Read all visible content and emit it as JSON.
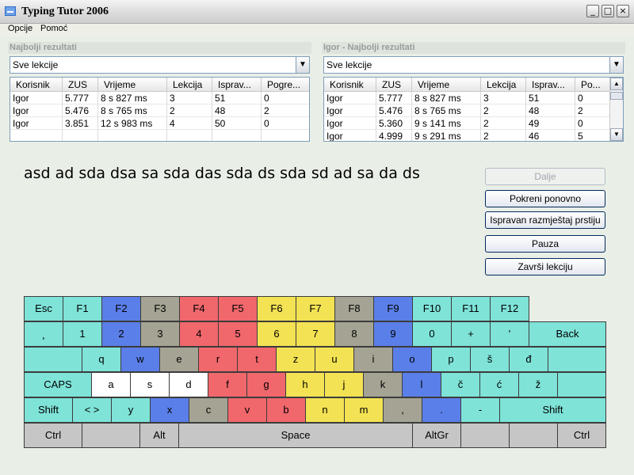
{
  "window": {
    "title": "Typing Tutor 2006",
    "buttons": [
      "_",
      "□",
      "×"
    ]
  },
  "menu": [
    "Opcije",
    "Pomoć"
  ],
  "panels": [
    {
      "title": "Najbolji rezultati",
      "filter": "Sve lekcije",
      "columns": [
        "Korisnik",
        "ZUS",
        "Vrijeme",
        "Lekcija",
        "Isprav...",
        "Pogre..."
      ],
      "rows": [
        [
          "Igor",
          "5.777",
          "8 s 827 ms",
          "3",
          "51",
          "0"
        ],
        [
          "Igor",
          "5.476",
          "8 s 765 ms",
          "2",
          "48",
          "2"
        ],
        [
          "Igor",
          "3.851",
          "12 s 983 ms",
          "4",
          "50",
          "0"
        ],
        [
          "",
          "",
          "",
          "",
          "",
          ""
        ]
      ],
      "scrollbar": false
    },
    {
      "title": "Igor - Najbolji rezultati",
      "filter": "Sve lekcije",
      "columns": [
        "Korisnik",
        "ZUS",
        "Vrijeme",
        "Lekcija",
        "Isprav...",
        "Po..."
      ],
      "rows": [
        [
          "Igor",
          "5.777",
          "8 s 827 ms",
          "3",
          "51",
          "0"
        ],
        [
          "Igor",
          "5.476",
          "8 s 765 ms",
          "2",
          "48",
          "2"
        ],
        [
          "Igor",
          "5.360",
          "9 s 141 ms",
          "2",
          "49",
          "0"
        ],
        [
          "Igor",
          "4.999",
          "9 s 291 ms",
          "2",
          "46",
          "5"
        ]
      ],
      "scrollbar": true
    }
  ],
  "lesson_text": "asd ad sda dsa sa sda das sda ds sda sd ad sa da ds",
  "actions": [
    {
      "label": "Dalje",
      "disabled": true
    },
    {
      "label": "Pokreni ponovno",
      "disabled": false
    },
    {
      "label": "Ispravan razmještaj prstiju",
      "disabled": false
    },
    {
      "label": "Pauza",
      "disabled": false
    },
    {
      "label": "Završi lekciju",
      "disabled": false
    }
  ],
  "colors": {
    "teal": "#7FE3D8",
    "blue": "#5B7FE8",
    "gray": "#A5A393",
    "red": "#F0676C",
    "yellow": "#F3E253",
    "white": "#FFFFFF",
    "light": "#C6C6C6"
  },
  "keyboard": [
    [
      {
        "label": "Esc",
        "color": "teal"
      },
      {
        "label": "F1",
        "color": "teal"
      },
      {
        "label": "F2",
        "color": "blue"
      },
      {
        "label": "F3",
        "color": "gray"
      },
      {
        "label": "F4",
        "color": "red"
      },
      {
        "label": "F5",
        "color": "red"
      },
      {
        "label": "F6",
        "color": "yellow"
      },
      {
        "label": "F7",
        "color": "yellow"
      },
      {
        "label": "F8",
        "color": "gray"
      },
      {
        "label": "F9",
        "color": "blue"
      },
      {
        "label": "F10",
        "color": "teal"
      },
      {
        "label": "F11",
        "color": "teal"
      },
      {
        "label": "F12",
        "color": "teal"
      }
    ],
    [
      {
        "label": "¸",
        "color": "teal"
      },
      {
        "label": "1",
        "color": "teal"
      },
      {
        "label": "2",
        "color": "blue"
      },
      {
        "label": "3",
        "color": "gray"
      },
      {
        "label": "4",
        "color": "red"
      },
      {
        "label": "5",
        "color": "red"
      },
      {
        "label": "6",
        "color": "yellow"
      },
      {
        "label": "7",
        "color": "yellow"
      },
      {
        "label": "8",
        "color": "gray"
      },
      {
        "label": "9",
        "color": "blue"
      },
      {
        "label": "0",
        "color": "teal"
      },
      {
        "label": "+",
        "color": "teal"
      },
      {
        "label": "'",
        "color": "teal"
      },
      {
        "label": "Back",
        "color": "teal"
      }
    ],
    [
      {
        "label": "",
        "color": "teal"
      },
      {
        "label": "q",
        "color": "teal"
      },
      {
        "label": "w",
        "color": "blue"
      },
      {
        "label": "e",
        "color": "gray"
      },
      {
        "label": "r",
        "color": "red"
      },
      {
        "label": "t",
        "color": "red"
      },
      {
        "label": "z",
        "color": "yellow"
      },
      {
        "label": "u",
        "color": "yellow"
      },
      {
        "label": "i",
        "color": "gray"
      },
      {
        "label": "o",
        "color": "blue"
      },
      {
        "label": "p",
        "color": "teal"
      },
      {
        "label": "š",
        "color": "teal"
      },
      {
        "label": "đ",
        "color": "teal"
      },
      {
        "label": "",
        "color": "teal"
      }
    ],
    [
      {
        "label": "CAPS",
        "color": "teal"
      },
      {
        "label": "a",
        "color": "white"
      },
      {
        "label": "s",
        "color": "white"
      },
      {
        "label": "d",
        "color": "white"
      },
      {
        "label": "f",
        "color": "red"
      },
      {
        "label": "g",
        "color": "red"
      },
      {
        "label": "h",
        "color": "yellow"
      },
      {
        "label": "j",
        "color": "yellow"
      },
      {
        "label": "k",
        "color": "gray"
      },
      {
        "label": "l",
        "color": "blue"
      },
      {
        "label": "č",
        "color": "teal"
      },
      {
        "label": "ć",
        "color": "teal"
      },
      {
        "label": "ž",
        "color": "teal"
      },
      {
        "label": "",
        "color": "teal"
      }
    ],
    [
      {
        "label": "Shift",
        "color": "teal"
      },
      {
        "label": "< >",
        "color": "teal"
      },
      {
        "label": "y",
        "color": "teal"
      },
      {
        "label": "x",
        "color": "blue"
      },
      {
        "label": "c",
        "color": "gray"
      },
      {
        "label": "v",
        "color": "red"
      },
      {
        "label": "b",
        "color": "red"
      },
      {
        "label": "n",
        "color": "yellow"
      },
      {
        "label": "m",
        "color": "yellow"
      },
      {
        "label": ",",
        "color": "gray"
      },
      {
        "label": ".",
        "color": "blue"
      },
      {
        "label": "-",
        "color": "teal"
      },
      {
        "label": "Shift",
        "color": "teal"
      }
    ],
    [
      {
        "label": "Ctrl",
        "color": "light"
      },
      {
        "label": "",
        "color": "light"
      },
      {
        "label": "Alt",
        "color": "light"
      },
      {
        "label": "Space",
        "color": "light"
      },
      {
        "label": "AltGr",
        "color": "light"
      },
      {
        "label": "",
        "color": "light"
      },
      {
        "label": "",
        "color": "light"
      },
      {
        "label": "Ctrl",
        "color": "light"
      }
    ]
  ]
}
